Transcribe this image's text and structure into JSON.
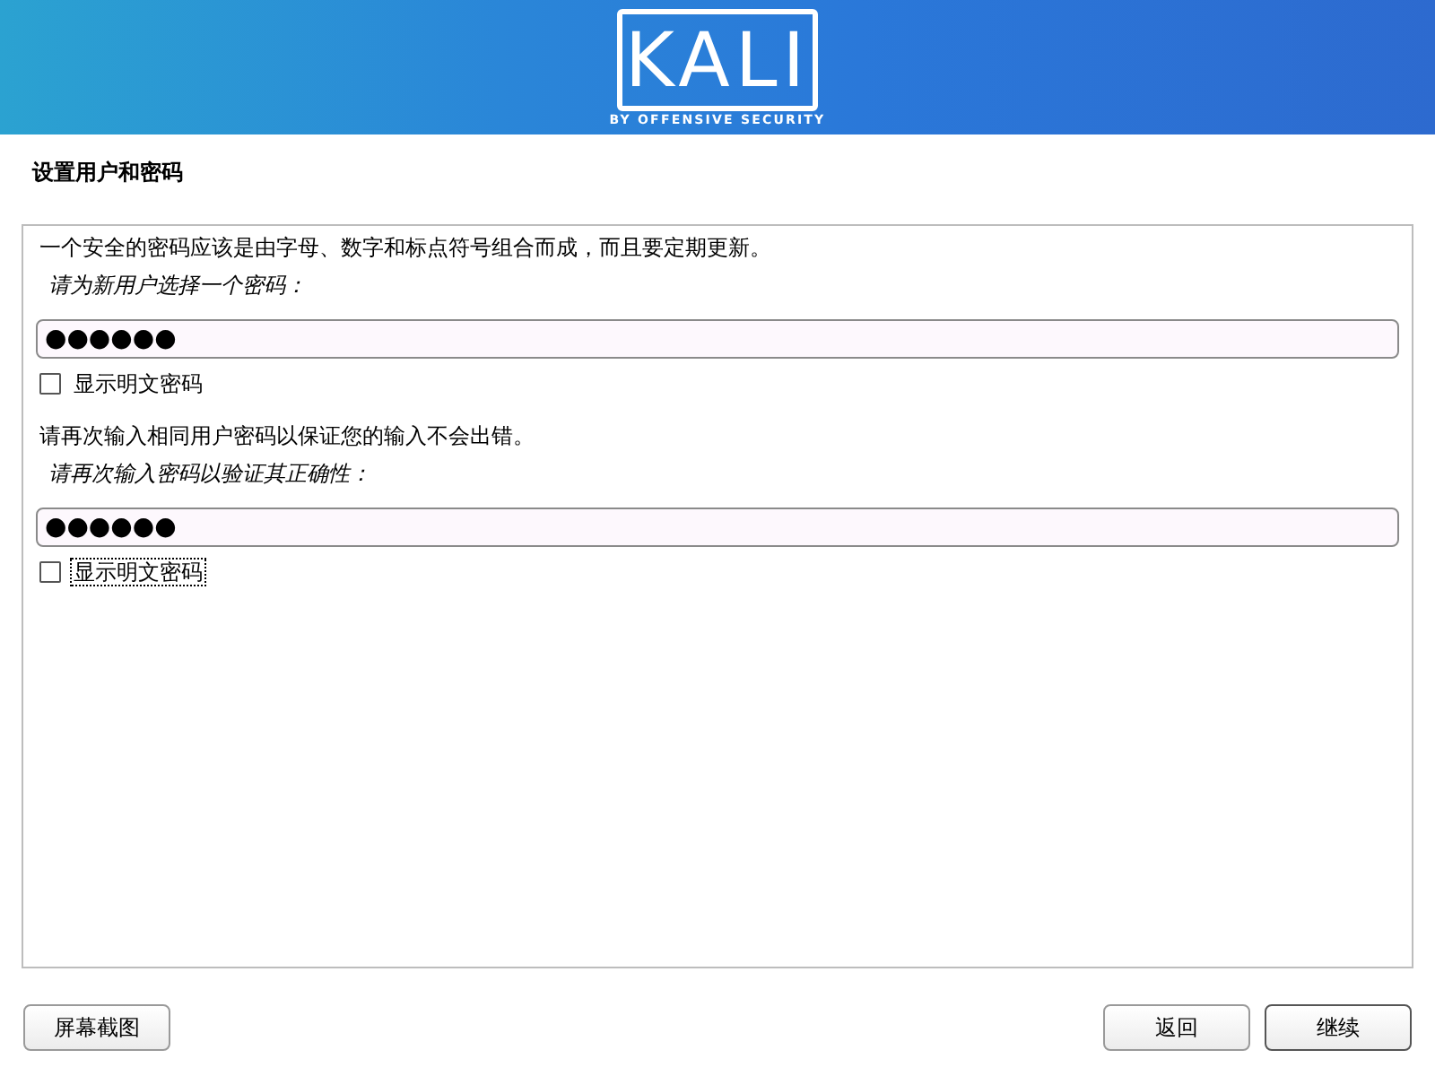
{
  "header": {
    "logo": {
      "wordmark": "KALI",
      "tagline": "BY OFFENSIVE SECURITY"
    }
  },
  "page_title": "设置用户和密码",
  "sections": [
    {
      "description": "一个安全的密码应该是由字母、数字和标点符号组合而成，而且要定期更新。",
      "prompt": "请为新用户选择一个密码：",
      "field": {
        "value": "●●●●●●"
      },
      "checkbox": {
        "label": "显示明文密码",
        "checked": false,
        "focused": false
      }
    },
    {
      "description": "请再次输入相同用户密码以保证您的输入不会出错。",
      "prompt": "请再次输入密码以验证其正确性：",
      "field": {
        "value": "●●●●●●"
      },
      "checkbox": {
        "label": "显示明文密码",
        "checked": false,
        "focused": true
      }
    }
  ],
  "footer": {
    "left_buttons": [
      {
        "label": "屏幕截图",
        "default": false
      }
    ],
    "right_buttons": [
      {
        "label": "返回",
        "default": false
      },
      {
        "label": "继续",
        "default": true
      }
    ]
  }
}
